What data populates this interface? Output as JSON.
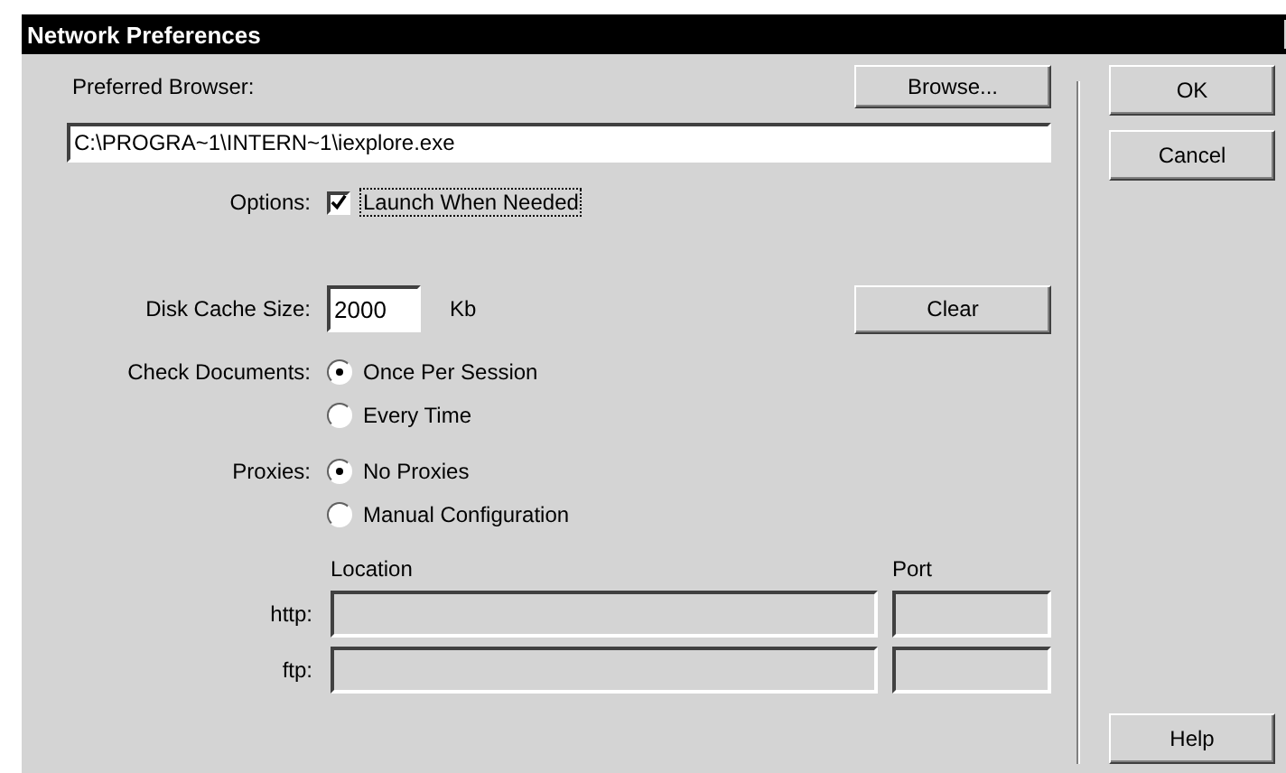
{
  "window": {
    "title": "Network Preferences"
  },
  "browser": {
    "label": "Preferred Browser:",
    "browse": "Browse...",
    "path": "C:\\PROGRA~1\\INTERN~1\\iexplore.exe"
  },
  "options": {
    "label": "Options:",
    "checkbox": {
      "label": "Launch When Needed",
      "checked": true
    }
  },
  "cache": {
    "label": "Disk Cache Size:",
    "value": "2000",
    "unit": "Kb",
    "clear": "Clear"
  },
  "check_documents": {
    "label": "Check Documents:",
    "choices": [
      {
        "label": "Once Per Session",
        "selected": true
      },
      {
        "label": "Every Time",
        "selected": false
      }
    ]
  },
  "proxies": {
    "label": "Proxies:",
    "choices": [
      {
        "label": "No Proxies",
        "selected": true
      },
      {
        "label": "Manual Configuration",
        "selected": false
      }
    ],
    "location_header": "Location",
    "port_header": "Port",
    "rows": [
      {
        "label": "http:",
        "disabled": true
      },
      {
        "label": "ftp:",
        "disabled": true
      }
    ]
  },
  "buttons": {
    "ok": "OK",
    "cancel": "Cancel",
    "help": "Help"
  }
}
